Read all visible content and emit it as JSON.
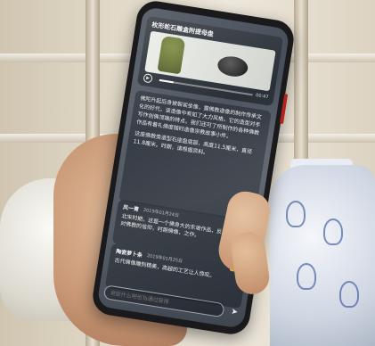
{
  "media": {
    "title": "枚形蛇石雕盒附提母盘",
    "time_elapsed": "",
    "time_total": "00:47",
    "progress": 0.15,
    "play_icon": "play-icon"
  },
  "article": {
    "para1": "佛陀升起后身披袈裟坐像，露佛教造像的制作传承文化的好代，该造像中有如了大力风格。它的造型对手写作创佛顶端的特点。我们还可了所制作的各种佛教作品有着礼佛度随时造像宗教故事小件。",
    "para2": "这座佛教类造型石座盘底部，高度11.5厘米，直径11.8厘米。时期，请根据资料。",
    "fold_label": "全文"
  },
  "comments": [
    {
      "name": "风一青",
      "date": "2019年01月24日",
      "likes": "1",
      "text": "北宋时期，这是一个佛身大的东坡作品，反映了北宋对佛教的信仰，时期佛像，之作。"
    },
    {
      "name": "陶瓷萝卜条",
      "date": "2019年01月25日",
      "likes": "0",
      "text": "古代佛像雕刻精美，高超的工艺让人惊叹。"
    }
  ],
  "input": {
    "placeholder": "说些什么吧也Ta通过获得"
  },
  "icons": {
    "like": "thumb-up-icon",
    "send": "send-icon"
  }
}
